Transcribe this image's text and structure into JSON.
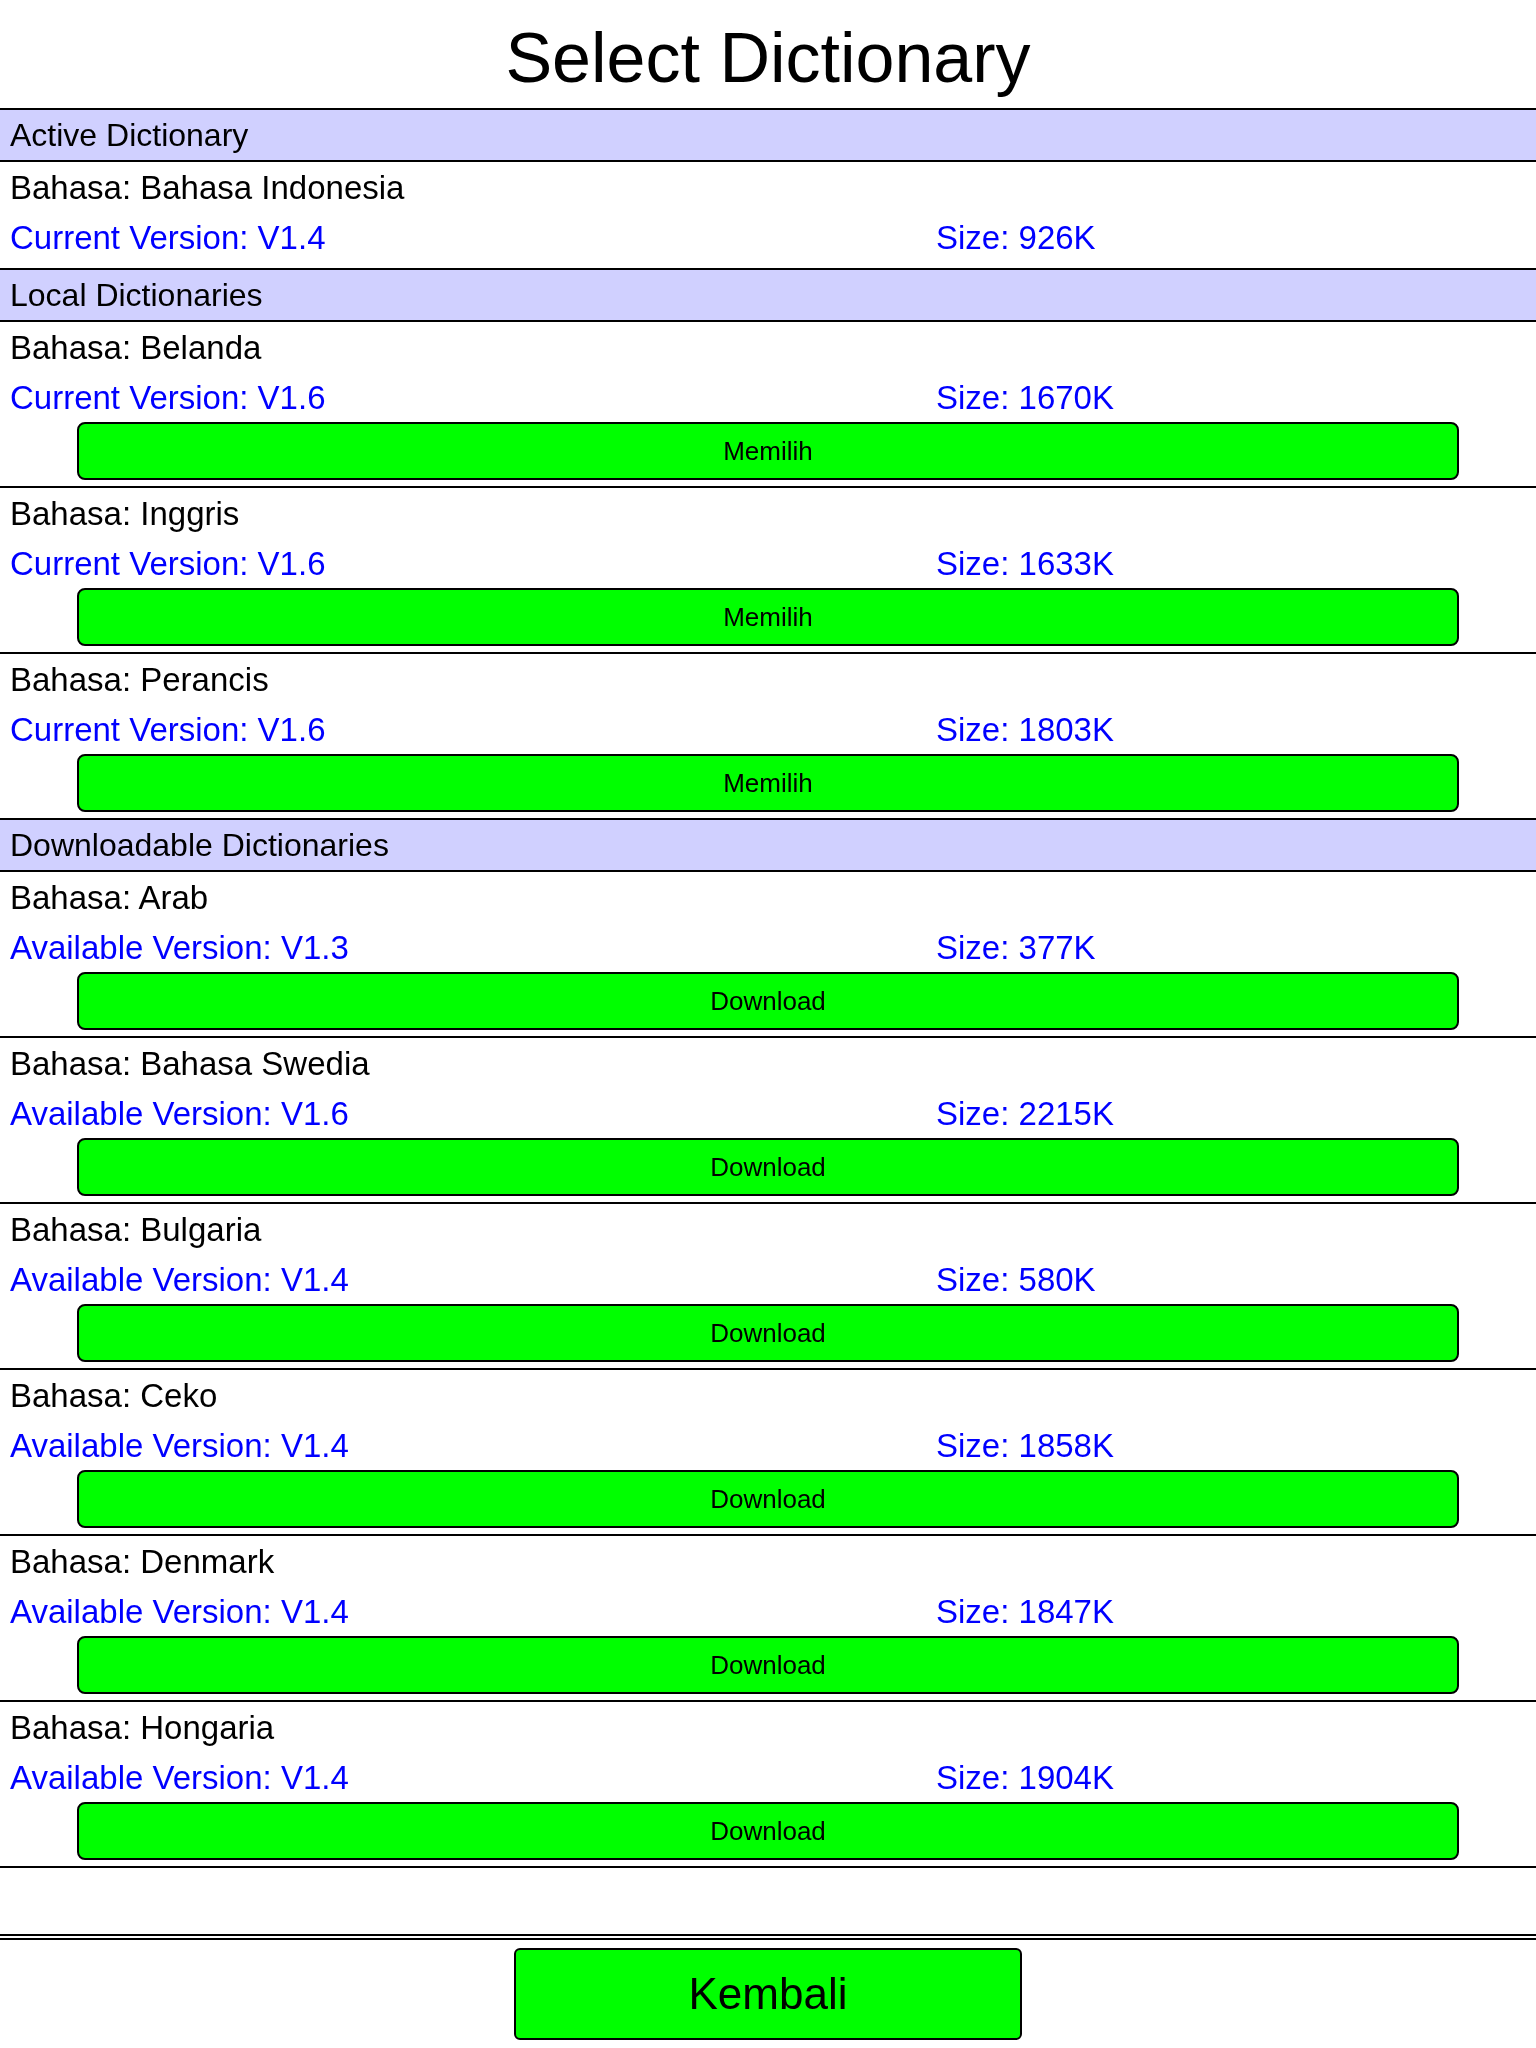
{
  "title": "Select Dictionary",
  "sections": [
    {
      "title": "Active Dictionary",
      "items": [
        {
          "language": "Bahasa: Bahasa Indonesia",
          "version": "Current Version: V1.4",
          "size": "Size: 926K"
        }
      ]
    },
    {
      "title": "Local Dictionaries",
      "items": [
        {
          "language": "Bahasa: Belanda",
          "version": "Current Version: V1.6",
          "size": "Size: 1670K",
          "button": "Memilih"
        },
        {
          "language": "Bahasa: Inggris",
          "version": "Current Version: V1.6",
          "size": "Size: 1633K",
          "button": "Memilih"
        },
        {
          "language": "Bahasa: Perancis",
          "version": "Current Version: V1.6",
          "size": "Size: 1803K",
          "button": "Memilih"
        }
      ]
    },
    {
      "title": "Downloadable Dictionaries",
      "items": [
        {
          "language": "Bahasa: Arab",
          "version": "Available Version: V1.3",
          "size": "Size: 377K",
          "button": "Download"
        },
        {
          "language": "Bahasa: Bahasa Swedia",
          "version": "Available Version: V1.6",
          "size": "Size: 2215K",
          "button": "Download"
        },
        {
          "language": "Bahasa: Bulgaria",
          "version": "Available Version: V1.4",
          "size": "Size: 580K",
          "button": "Download"
        },
        {
          "language": "Bahasa: Ceko",
          "version": "Available Version: V1.4",
          "size": "Size: 1858K",
          "button": "Download"
        },
        {
          "language": "Bahasa: Denmark",
          "version": "Available Version: V1.4",
          "size": "Size: 1847K",
          "button": "Download"
        },
        {
          "language": "Bahasa: Hongaria",
          "version": "Available Version: V1.4",
          "size": "Size: 1904K",
          "button": "Download"
        }
      ]
    }
  ],
  "back_button": "Kembali"
}
